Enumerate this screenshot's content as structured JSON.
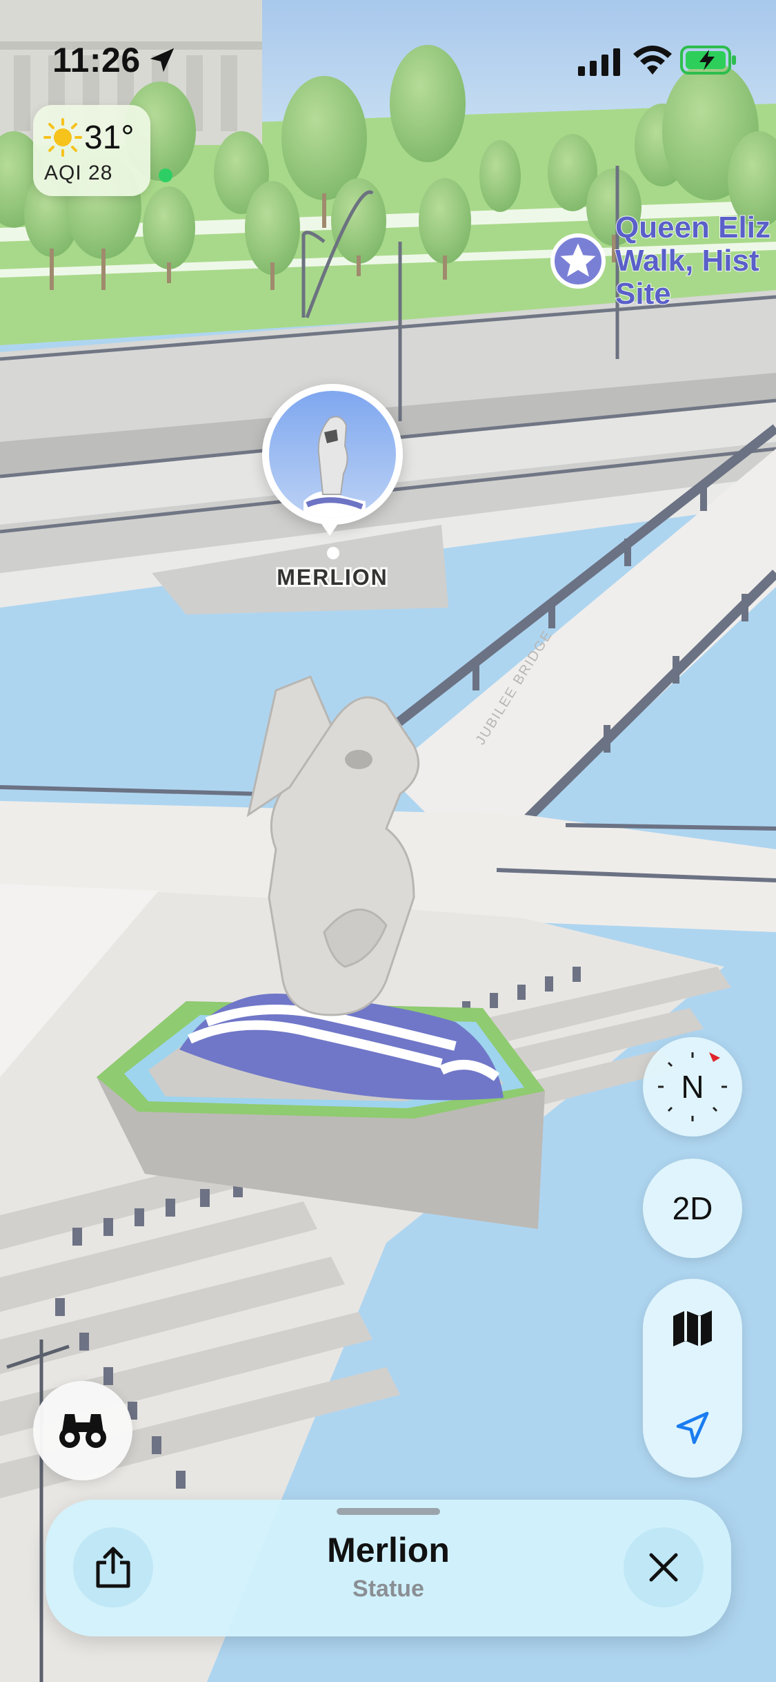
{
  "status_bar": {
    "time": "11:26",
    "icons": [
      "location-arrow-icon",
      "cellular-signal-icon",
      "wifi-icon",
      "battery-charging-icon"
    ]
  },
  "weather": {
    "icon": "sun-icon",
    "temperature": "31°",
    "aqi": "AQI 28",
    "aqi_status_color": "#2dcf64"
  },
  "map": {
    "poi": {
      "icon": "star-icon",
      "label": "Queen Eliz\nWalk, Hist\nSite"
    },
    "selected_pin": {
      "label": "MERLION",
      "image": "merlion-statue-thumbnail"
    },
    "road_label": "JUBILEE BRIDGE"
  },
  "controls": {
    "compass_label": "N",
    "view_toggle_label": "2D",
    "map_mode_icon": "map-icon",
    "current_location_icon": "location-arrow-icon",
    "look_around_icon": "binoculars-icon",
    "accent_color": "#1a7cf0"
  },
  "place_card": {
    "title": "Merlion",
    "subtitle": "Statue",
    "share_icon": "share-icon",
    "close_icon": "close-icon"
  }
}
